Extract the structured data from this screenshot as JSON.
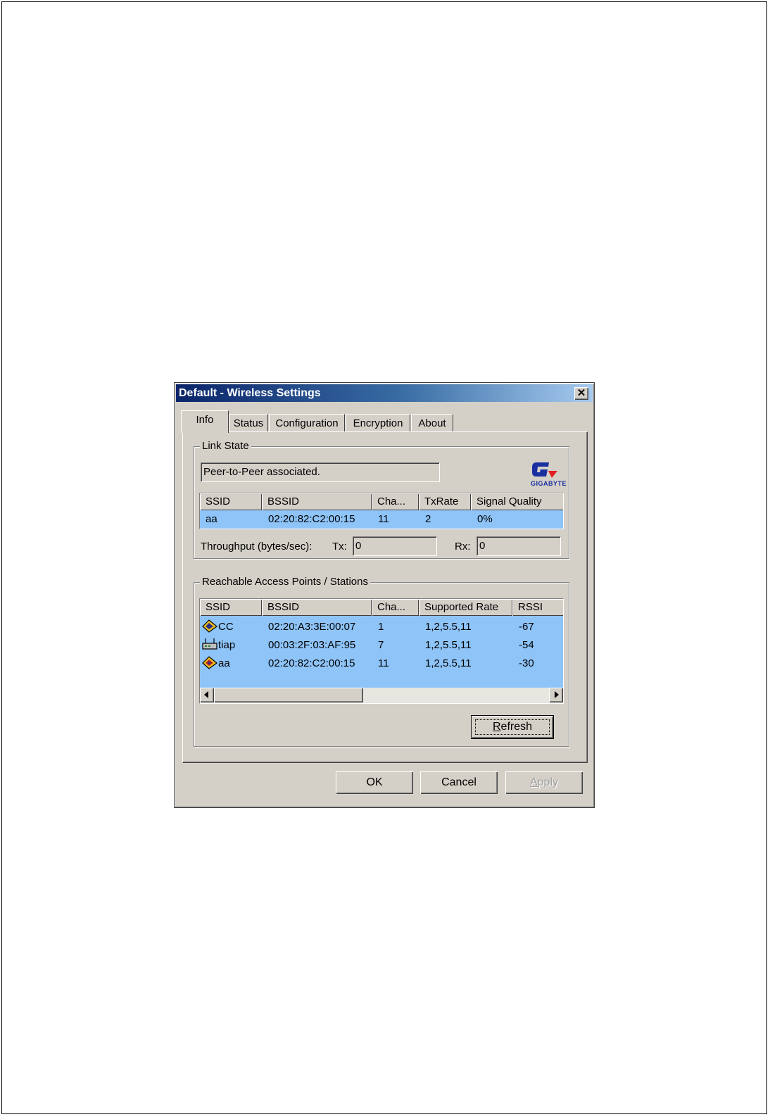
{
  "window": {
    "title": "Default - Wireless Settings",
    "close_label": "✕"
  },
  "tabs": [
    {
      "label": "Info",
      "active": true
    },
    {
      "label": "Status"
    },
    {
      "label": "Configuration"
    },
    {
      "label": "Encryption"
    },
    {
      "label": "About"
    }
  ],
  "link_state": {
    "legend": "Link State",
    "status_text": "Peer-to-Peer associated.",
    "logo_text": "GIGABYTE",
    "columns": [
      "SSID",
      "BSSID",
      "Cha...",
      "TxRate",
      "Signal Quality"
    ],
    "row": {
      "ssid": "aa",
      "bssid": "02:20:82:C2:00:15",
      "channel": "11",
      "txrate": "2",
      "signal": "0%"
    },
    "throughput_label": "Throughput (bytes/sec):",
    "tx_label": "Tx:",
    "tx_value": "0",
    "rx_label": "Rx:",
    "rx_value": "0"
  },
  "reachable": {
    "legend": "Reachable Access Points / Stations",
    "columns": [
      "SSID",
      "BSSID",
      "Cha...",
      "Supported Rate",
      "RSSI"
    ],
    "rows": [
      {
        "icon": "adhoc-station-icon",
        "ssid": "CC",
        "bssid": "02:20:A3:3E:00:07",
        "channel": "1",
        "rate": "1,2,5.5,11",
        "rssi": "-67"
      },
      {
        "icon": "access-point-icon",
        "ssid": "tiap",
        "bssid": "00:03:2F:03:AF:95",
        "channel": "7",
        "rate": "1,2,5.5,11",
        "rssi": "-54"
      },
      {
        "icon": "associated-station-icon",
        "ssid": "aa",
        "bssid": "02:20:82:C2:00:15",
        "channel": "11",
        "rate": "1,2,5.5,11",
        "rssi": "-30"
      }
    ],
    "refresh_label_underlined": "R",
    "refresh_label_rest": "efresh"
  },
  "footer": {
    "ok_label": "OK",
    "cancel_label": "Cancel",
    "apply_label_underlined": "A",
    "apply_label_rest": "pply"
  },
  "colors": {
    "list_selection": "#8ec4f8",
    "dialog_face": "#d4d0c8",
    "title_start": "#0a246a",
    "title_end": "#a6caf0"
  }
}
